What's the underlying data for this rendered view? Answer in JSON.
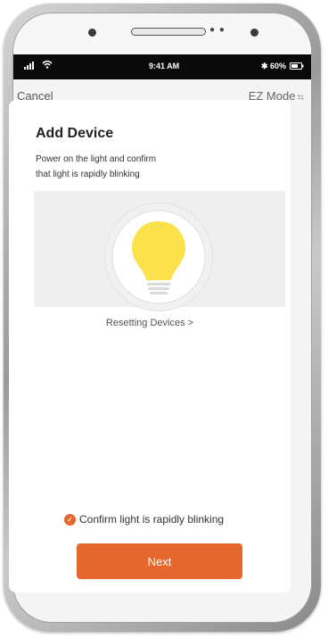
{
  "status": {
    "time": "9:41 AM",
    "battery": "60%"
  },
  "nav": {
    "cancel_label": "Cancel",
    "mode_label": "EZ Mode"
  },
  "content": {
    "title": "Add Device",
    "description_line1": "Power on the light and confirm",
    "description_line2": "that light is rapidly blinking",
    "reset_link": "Resetting Devices >",
    "confirm_label": "Confirm light is rapidly blinking",
    "confirm_checked": true
  },
  "actions": {
    "next_label": "Next"
  },
  "icons": {
    "illustration": "light-bulb-icon",
    "confirm": "check-circle-icon",
    "mode_switch": "swap-arrows-icon"
  },
  "colors": {
    "accent": "#e5672d",
    "bulb": "#fbe24a",
    "status_bar": "#0a0a0a"
  }
}
